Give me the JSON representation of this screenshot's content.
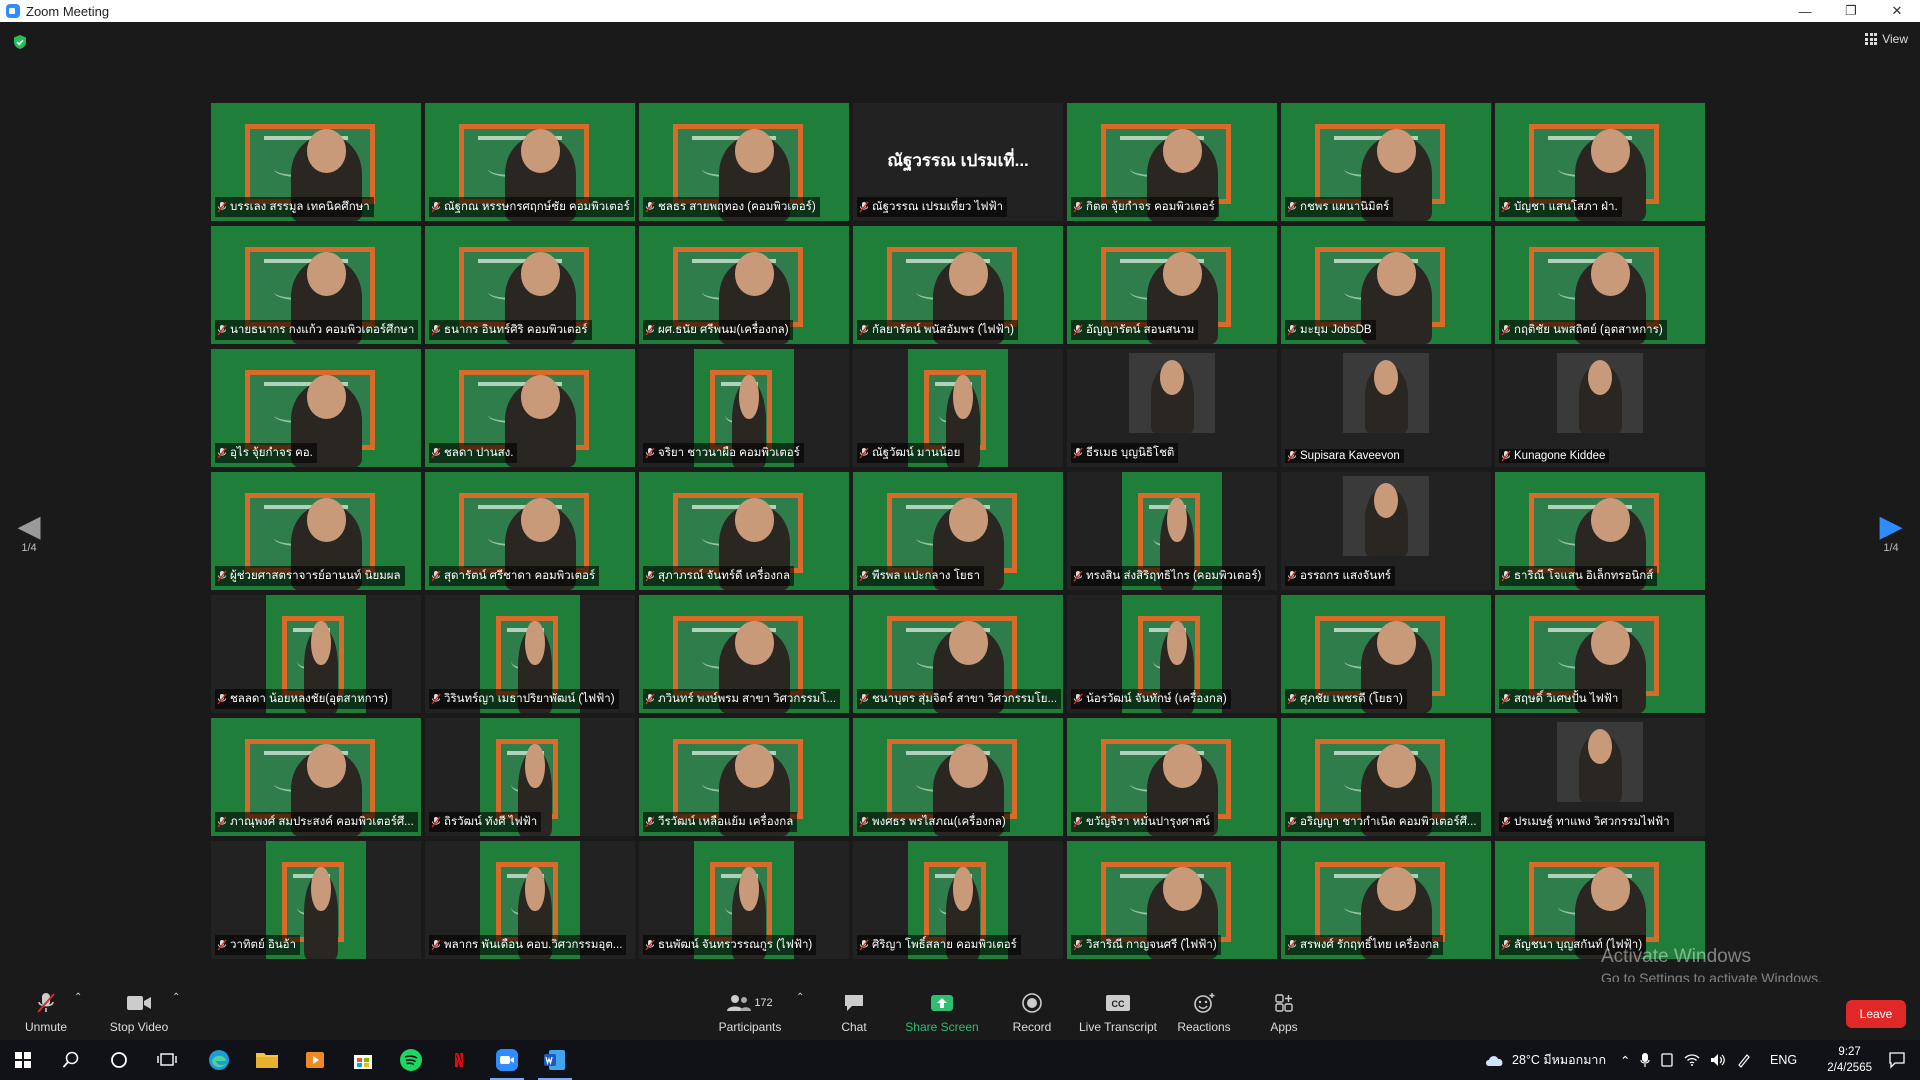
{
  "window": {
    "title": "Zoom Meeting",
    "controls": [
      "—",
      "❐",
      "✕"
    ]
  },
  "top": {
    "view_label": "View"
  },
  "page_indicator": {
    "left": "1/4",
    "right": "1/4"
  },
  "tiles": [
    {
      "name": "บรรเลง สรรมูล เทคนิคศึกษา",
      "video": "board",
      "active": true
    },
    {
      "name": "ณัฐกณ หรรษกรศฤกษ์ชัย คอมพิวเตอร์",
      "video": "board"
    },
    {
      "name": "ชลธร สายพฤทอง (คอมพิวเตอร์)",
      "video": "board"
    },
    {
      "name": "ณัฐวรรณ เปรมเที่ยว ไฟฟ้า",
      "video": "none",
      "big_name": "ณัฐวรรณ เปรมเที่..."
    },
    {
      "name": "กิตต จุ้ยกำจร คอมพิวเตอร์",
      "video": "board"
    },
    {
      "name": "กชพร แผนานิมิตร์",
      "video": "board"
    },
    {
      "name": "บัญชา แสนโสภา ฝ่า.",
      "video": "board"
    },
    {
      "name": "นายธนากร กงแก้ว คอมพิวเตอร์ศึกษา",
      "video": "board"
    },
    {
      "name": "ธนากร อินทร์ศิริ คอมพิวเตอร์",
      "video": "board"
    },
    {
      "name": "ผศ.ธนัย ศรีพนม(เครื่องกล)",
      "video": "board"
    },
    {
      "name": "กัลยารัตน์ พนัสอัมพร (ไฟฟ้า)",
      "video": "board"
    },
    {
      "name": "อัญญารัตน์ สอนสนาม",
      "video": "board"
    },
    {
      "name": "มะยุม JobsDB",
      "video": "board"
    },
    {
      "name": "กฤติชัย นพสถิตย์ (อุตสาหการ)",
      "video": "board"
    },
    {
      "name": "อุไร จุ้ยกำจร คอ.",
      "video": "board"
    },
    {
      "name": "ชลดา ปานสง.",
      "video": "board"
    },
    {
      "name": "จริยา ชาวนาผือ คอมพิวเตอร์",
      "video": "narrow"
    },
    {
      "name": "ณัฐวัฒน์ มานน้อย",
      "video": "narrow"
    },
    {
      "name": "ธีรเมธ บุญนิธิโชติ",
      "video": "photo"
    },
    {
      "name": "Supisara Kaveevon",
      "video": "photo"
    },
    {
      "name": "Kunagone Kiddee",
      "video": "photo"
    },
    {
      "name": "ผู้ช่วยศาสตราจารย์อานนท์ นิยมผล",
      "video": "board"
    },
    {
      "name": "สุดารัตน์ ศรีชาดา คอมพิวเตอร์",
      "video": "board"
    },
    {
      "name": "สุภาภรณ์ จันทร์ดี เครื่องกล",
      "video": "board"
    },
    {
      "name": "พีรพล แปะกลาง โยธา",
      "video": "board"
    },
    {
      "name": "ทรงสิน ส่งสิริฤทธิไกร (คอมพิวเตอร์)",
      "video": "narrow"
    },
    {
      "name": "อรรถกร แสงจันทร์",
      "video": "photo"
    },
    {
      "name": "ธาริณี โจแสน อิเล็กทรอนิกส์",
      "video": "board"
    },
    {
      "name": "ชลลดา น้อยหลงชัย(อุตสาหการ)",
      "video": "narrow"
    },
    {
      "name": "วิรินทร์ญา เมธาปริยาพัฒน์ (ไฟฟ้า)",
      "video": "narrow"
    },
    {
      "name": "ภวินทร์ พงษ์พรม สาขา วิศวกรรมโ...",
      "video": "board"
    },
    {
      "name": "ชนาบุตร สุ่มจิตร์ สาขา วิศวกรรมโย...",
      "video": "board"
    },
    {
      "name": "น้อรวัฒน์ จันทักษ์ (เครื่องกล)",
      "video": "narrow"
    },
    {
      "name": "ศุภชัย เพชรดี (โยธา)",
      "video": "board"
    },
    {
      "name": "สฤษดิ์ วิเศษปั้น ไฟฟ้า",
      "video": "board"
    },
    {
      "name": "ภาณุพงศ์ สมประสงค์ คอมพิวเตอร์ศึ...",
      "video": "board"
    },
    {
      "name": "ถิรวัฒน์ ทังศี ไฟฟ้า",
      "video": "narrow"
    },
    {
      "name": "วีรวัฒน์ เหลือแย้ม เครื่องกล",
      "video": "board"
    },
    {
      "name": "พงศธร พรไสภณ(เครื่องกล)",
      "video": "board"
    },
    {
      "name": "ขวัญจิรา หมั่นปารุงศาสน์",
      "video": "board"
    },
    {
      "name": "อริญญา ชาวกำเนิด คอมพิวเตอร์ศึ...",
      "video": "board"
    },
    {
      "name": "ปรเมษฐ์ ทาแพง วิศวกรรมไฟฟ้า",
      "video": "photo"
    },
    {
      "name": "วาทิตย์ อินอ้า",
      "video": "narrow"
    },
    {
      "name": "พลากร พันเดือน คอบ.วิศวกรรมอุต...",
      "video": "narrow"
    },
    {
      "name": "ธนพัฒน์ จันทรวรรณกูร (ไฟฟ้า)",
      "video": "narrow"
    },
    {
      "name": "ศิริญา โพธิ์สลาย คอมพิวเตอร์",
      "video": "narrow"
    },
    {
      "name": "วิสาริณี กาญจนศรี (ไฟฟ้า)",
      "video": "board"
    },
    {
      "name": "สรพงศ์ รักฤทธิ์ไทย เครื่องกล",
      "video": "board"
    },
    {
      "name": "ลัญชนา บุญสกันท์ (ไฟฟ้า)",
      "video": "board"
    }
  ],
  "watermark": {
    "title": "Activate Windows",
    "subtitle": "Go to Settings to activate Windows."
  },
  "toolbar": {
    "unmute": "Unmute",
    "stop_video": "Stop Video",
    "participants": "Participants",
    "participants_count": "172",
    "chat": "Chat",
    "share_screen": "Share Screen",
    "record": "Record",
    "live_transcript": "Live Transcript",
    "reactions": "Reactions",
    "apps": "Apps",
    "leave": "Leave"
  },
  "taskbar": {
    "weather": "28°C มีหมอกมาก",
    "language": "ENG",
    "time": "9:27",
    "date": "2/4/2565"
  },
  "colors": {
    "accent_blue": "#2d8cff",
    "share_green": "#2fbf71",
    "leave_red": "#e02828",
    "active_speaker": "#e6ef3c"
  }
}
